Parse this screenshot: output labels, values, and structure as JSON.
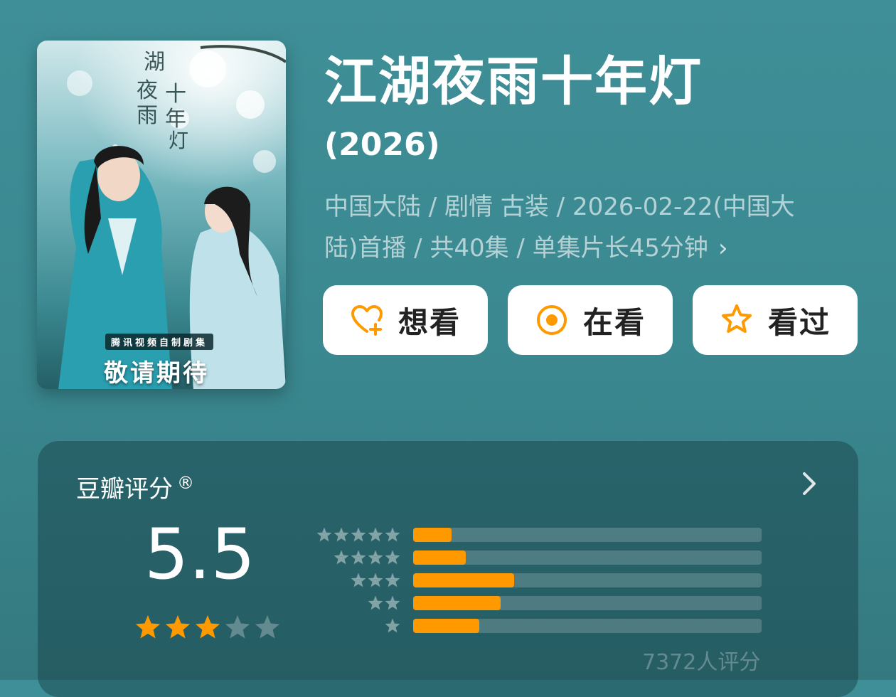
{
  "poster": {
    "title_art": "江湖夜雨十年灯",
    "tag": "腾讯视频自制剧集",
    "coming_soon": "敬请期待"
  },
  "header": {
    "title": "江湖夜雨十年灯",
    "year": "(2026)",
    "meta_line1": "中国大陆 / 剧情 古装 / 2026-02-22(中国大",
    "meta_line2": "陆)首播 / 共40集 / 单集片长45分钟",
    "meta_chevron": "›"
  },
  "actions": {
    "want_label": "想看",
    "watching_label": "在看",
    "watched_label": "看过",
    "icon_color": "#ff9900"
  },
  "rating": {
    "title": "豆瓣评分",
    "registered_mark": "®",
    "score": "5.5",
    "star_fraction": 0.55,
    "count_text": "7372人评分",
    "distribution": [
      {
        "stars": 5,
        "fraction": 0.11
      },
      {
        "stars": 4,
        "fraction": 0.15
      },
      {
        "stars": 3,
        "fraction": 0.29
      },
      {
        "stars": 2,
        "fraction": 0.25
      },
      {
        "stars": 1,
        "fraction": 0.19
      }
    ],
    "bar_color": "#ff9900",
    "star_color": "#ff9900"
  }
}
